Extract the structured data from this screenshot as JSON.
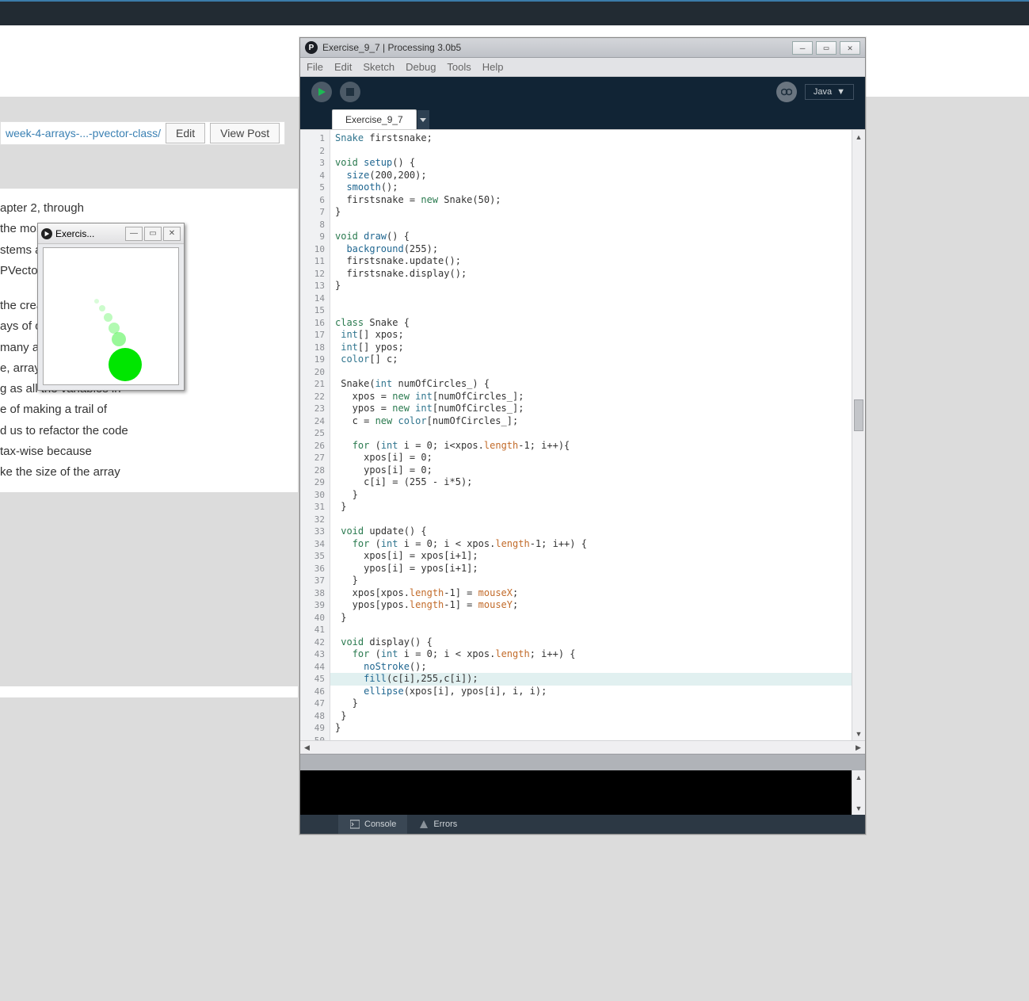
{
  "browser": {
    "breadcrumb": "week-4-arrays-...-pvector-class/",
    "edit_btn": "Edit",
    "view_btn": "View Post"
  },
  "article": {
    "lines1": [
      "apter 2, through",
      " the more",
      "stems and",
      "PVector (which"
    ],
    "lines2": [
      " the creation of",
      "ays of objects, now I",
      "many as I'd like, with",
      "e, arrays need not be",
      "g as all the variables in",
      "e of making a trail of",
      "d us to refactor the code",
      "tax-wise because",
      "ke the size of the array"
    ]
  },
  "sketch": {
    "title": "Exercis..."
  },
  "ide": {
    "title": "Exercise_9_7 | Processing 3.0b5",
    "menu": [
      "File",
      "Edit",
      "Sketch",
      "Debug",
      "Tools",
      "Help"
    ],
    "mode": "Java",
    "tab": "Exercise_9_7",
    "bottom": {
      "console": "Console",
      "errors": "Errors"
    },
    "highlight_line": 45,
    "code": [
      {
        "n": 1,
        "t": [
          [
            "ty",
            "Snake"
          ],
          [
            "nm",
            " firstsnake;"
          ]
        ]
      },
      {
        "n": 2,
        "t": []
      },
      {
        "n": 3,
        "t": [
          [
            "kw",
            "void "
          ],
          [
            "fn",
            "setup"
          ],
          [
            "nm",
            "() {"
          ]
        ]
      },
      {
        "n": 4,
        "t": [
          [
            "nm",
            "  "
          ],
          [
            "fn",
            "size"
          ],
          [
            "nm",
            "(200,200);"
          ]
        ]
      },
      {
        "n": 5,
        "t": [
          [
            "nm",
            "  "
          ],
          [
            "fn",
            "smooth"
          ],
          [
            "nm",
            "();"
          ]
        ]
      },
      {
        "n": 6,
        "t": [
          [
            "nm",
            "  firstsnake = "
          ],
          [
            "kw",
            "new"
          ],
          [
            "nm",
            " Snake(50);"
          ]
        ]
      },
      {
        "n": 7,
        "t": [
          [
            "nm",
            "}"
          ]
        ]
      },
      {
        "n": 8,
        "t": []
      },
      {
        "n": 9,
        "t": [
          [
            "kw",
            "void "
          ],
          [
            "fn",
            "draw"
          ],
          [
            "nm",
            "() {"
          ]
        ]
      },
      {
        "n": 10,
        "t": [
          [
            "nm",
            "  "
          ],
          [
            "fn",
            "background"
          ],
          [
            "nm",
            "(255);"
          ]
        ]
      },
      {
        "n": 11,
        "t": [
          [
            "nm",
            "  firstsnake.update();"
          ]
        ]
      },
      {
        "n": 12,
        "t": [
          [
            "nm",
            "  firstsnake.display();"
          ]
        ]
      },
      {
        "n": 13,
        "t": [
          [
            "nm",
            "}"
          ]
        ]
      },
      {
        "n": 14,
        "t": []
      },
      {
        "n": 15,
        "t": []
      },
      {
        "n": 16,
        "t": [
          [
            "kw",
            "class"
          ],
          [
            "nm",
            " Snake {"
          ]
        ]
      },
      {
        "n": 17,
        "t": [
          [
            "nm",
            " "
          ],
          [
            "ty",
            "int"
          ],
          [
            "nm",
            "[] xpos;"
          ]
        ]
      },
      {
        "n": 18,
        "t": [
          [
            "nm",
            " "
          ],
          [
            "ty",
            "int"
          ],
          [
            "nm",
            "[] ypos;"
          ]
        ]
      },
      {
        "n": 19,
        "t": [
          [
            "nm",
            " "
          ],
          [
            "ty",
            "color"
          ],
          [
            "nm",
            "[] c;"
          ]
        ]
      },
      {
        "n": 20,
        "t": []
      },
      {
        "n": 21,
        "t": [
          [
            "nm",
            " Snake("
          ],
          [
            "ty",
            "int"
          ],
          [
            "nm",
            " numOfCircles_) {"
          ]
        ]
      },
      {
        "n": 22,
        "t": [
          [
            "nm",
            "   xpos = "
          ],
          [
            "kw",
            "new "
          ],
          [
            "ty",
            "int"
          ],
          [
            "nm",
            "[numOfCircles_];"
          ]
        ]
      },
      {
        "n": 23,
        "t": [
          [
            "nm",
            "   ypos = "
          ],
          [
            "kw",
            "new "
          ],
          [
            "ty",
            "int"
          ],
          [
            "nm",
            "[numOfCircles_];"
          ]
        ]
      },
      {
        "n": 24,
        "t": [
          [
            "nm",
            "   c = "
          ],
          [
            "kw",
            "new "
          ],
          [
            "ty",
            "color"
          ],
          [
            "nm",
            "[numOfCircles_];"
          ]
        ]
      },
      {
        "n": 25,
        "t": []
      },
      {
        "n": 26,
        "t": [
          [
            "nm",
            "   "
          ],
          [
            "kw",
            "for"
          ],
          [
            "nm",
            " ("
          ],
          [
            "ty",
            "int"
          ],
          [
            "nm",
            " i = 0; i<xpos."
          ],
          [
            "pr",
            "length"
          ],
          [
            "nm",
            "-1; i++){"
          ]
        ]
      },
      {
        "n": 27,
        "t": [
          [
            "nm",
            "     xpos[i] = 0;"
          ]
        ]
      },
      {
        "n": 28,
        "t": [
          [
            "nm",
            "     ypos[i] = 0;"
          ]
        ]
      },
      {
        "n": 29,
        "t": [
          [
            "nm",
            "     c[i] = (255 - i*5);"
          ]
        ]
      },
      {
        "n": 30,
        "t": [
          [
            "nm",
            "   }"
          ]
        ]
      },
      {
        "n": 31,
        "t": [
          [
            "nm",
            " }"
          ]
        ]
      },
      {
        "n": 32,
        "t": []
      },
      {
        "n": 33,
        "t": [
          [
            "nm",
            " "
          ],
          [
            "kw",
            "void"
          ],
          [
            "nm",
            " update() {"
          ]
        ]
      },
      {
        "n": 34,
        "t": [
          [
            "nm",
            "   "
          ],
          [
            "kw",
            "for"
          ],
          [
            "nm",
            " ("
          ],
          [
            "ty",
            "int"
          ],
          [
            "nm",
            " i = 0; i < xpos."
          ],
          [
            "pr",
            "length"
          ],
          [
            "nm",
            "-1; i++) {"
          ]
        ]
      },
      {
        "n": 35,
        "t": [
          [
            "nm",
            "     xpos[i] = xpos[i+1];"
          ]
        ]
      },
      {
        "n": 36,
        "t": [
          [
            "nm",
            "     ypos[i] = ypos[i+1];"
          ]
        ]
      },
      {
        "n": 37,
        "t": [
          [
            "nm",
            "   }"
          ]
        ]
      },
      {
        "n": 38,
        "t": [
          [
            "nm",
            "   xpos[xpos."
          ],
          [
            "pr",
            "length"
          ],
          [
            "nm",
            "-1] = "
          ],
          [
            "pr",
            "mouseX"
          ],
          [
            "nm",
            ";"
          ]
        ]
      },
      {
        "n": 39,
        "t": [
          [
            "nm",
            "   ypos[ypos."
          ],
          [
            "pr",
            "length"
          ],
          [
            "nm",
            "-1] = "
          ],
          [
            "pr",
            "mouseY"
          ],
          [
            "nm",
            ";"
          ]
        ]
      },
      {
        "n": 40,
        "t": [
          [
            "nm",
            " }"
          ]
        ]
      },
      {
        "n": 41,
        "t": []
      },
      {
        "n": 42,
        "t": [
          [
            "nm",
            " "
          ],
          [
            "kw",
            "void"
          ],
          [
            "nm",
            " display() {"
          ]
        ]
      },
      {
        "n": 43,
        "t": [
          [
            "nm",
            "   "
          ],
          [
            "kw",
            "for"
          ],
          [
            "nm",
            " ("
          ],
          [
            "ty",
            "int"
          ],
          [
            "nm",
            " i = 0; i < xpos."
          ],
          [
            "pr",
            "length"
          ],
          [
            "nm",
            "; i++) {"
          ]
        ]
      },
      {
        "n": 44,
        "t": [
          [
            "nm",
            "     "
          ],
          [
            "fn",
            "noStroke"
          ],
          [
            "nm",
            "();"
          ]
        ]
      },
      {
        "n": 45,
        "t": [
          [
            "nm",
            "     "
          ],
          [
            "fn",
            "fill"
          ],
          [
            "nm",
            "(c[i],255,c[i]);"
          ]
        ]
      },
      {
        "n": 46,
        "t": [
          [
            "nm",
            "     "
          ],
          [
            "fn",
            "ellipse"
          ],
          [
            "nm",
            "(xpos[i], ypos[i], i, i);"
          ]
        ]
      },
      {
        "n": 47,
        "t": [
          [
            "nm",
            "   }"
          ]
        ]
      },
      {
        "n": 48,
        "t": [
          [
            "nm",
            " }"
          ]
        ]
      },
      {
        "n": 49,
        "t": [
          [
            "nm",
            "}"
          ]
        ]
      },
      {
        "n": 50,
        "t": []
      }
    ]
  }
}
